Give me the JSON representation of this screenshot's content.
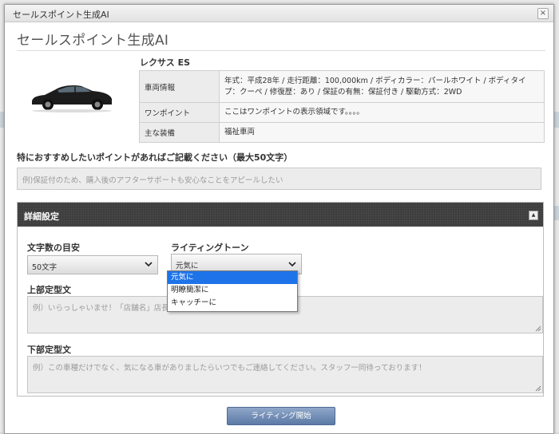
{
  "window": {
    "title": "セールスポイント生成AI",
    "close": "×"
  },
  "page": {
    "heading": "セールスポイント生成AI"
  },
  "car": {
    "name": "レクサス ES",
    "rows": [
      {
        "key": "車両情報",
        "value": "年式：平成28年 / 走行距離：100,000km / ボディカラー：パールホワイト / ボディタイプ：クーペ / 修復歴：あり / 保証の有無：保証付き / 駆動方式：2WD"
      },
      {
        "key": "ワンポイント",
        "value": "ここはワンポイントの表示領域です。。。。"
      },
      {
        "key": "主な装備",
        "value": "福祉車両"
      }
    ]
  },
  "recommend": {
    "label": "特におすすめしたいポイントがあればご記載ください（最大50文字）",
    "placeholder": "例)保証付のため、購入後のアフターサポートも安心なことをアピールしたい"
  },
  "detail": {
    "title": "詳細設定",
    "char_count": {
      "label": "文字数の目安",
      "value": "50文字"
    },
    "tone": {
      "label": "ライティングトーン",
      "value": "元気に",
      "options": [
        "元気に",
        "明瞭簡潔に",
        "キャッチーに"
      ]
    },
    "top_text": {
      "label": "上部定型文",
      "placeholder": "例）いらっしゃいませ！「店舗名」店長の"
    },
    "bottom_text": {
      "label": "下部定型文",
      "placeholder": "例）この車種だけでなく、気になる車がありましたらいつでもご連絡してください。スタッフ一同待っております！"
    }
  },
  "actions": {
    "start": "ライティング開始"
  },
  "colors": {
    "header_dark": "#3d3d3d",
    "button_blue": "#6f8bb5",
    "selected_option": "#1e73e8"
  }
}
